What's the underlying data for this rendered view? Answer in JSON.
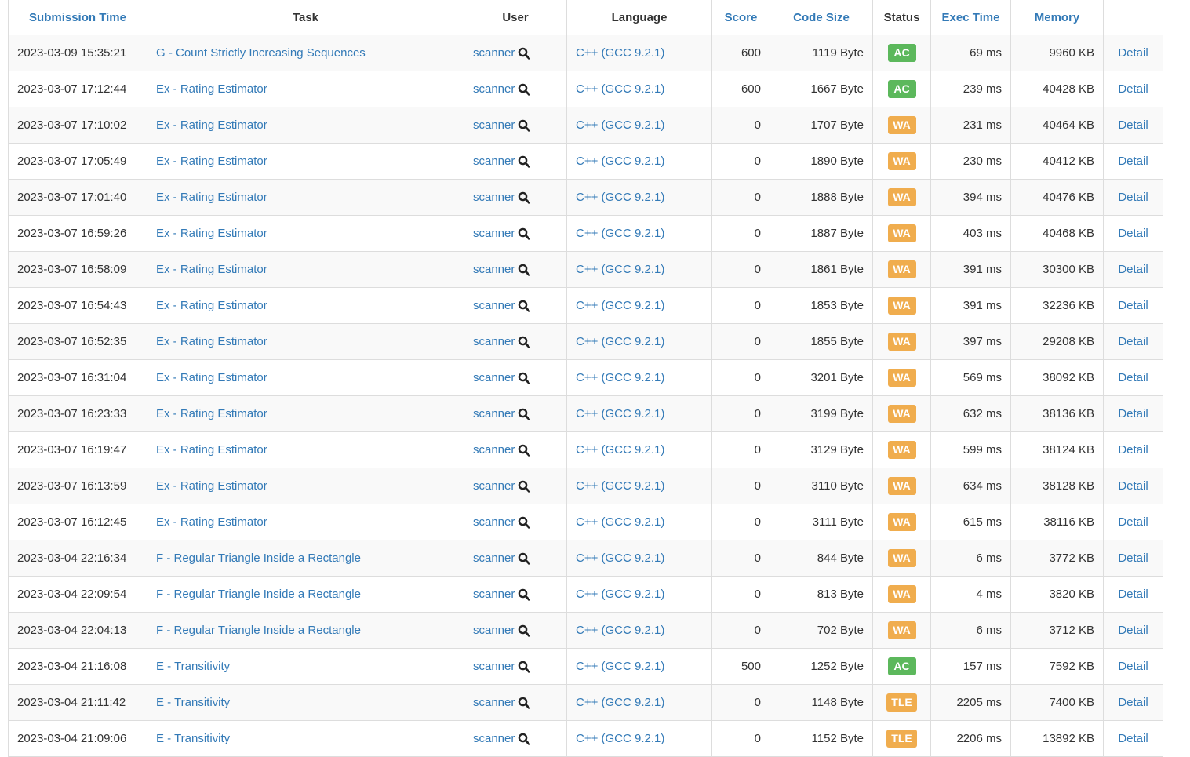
{
  "colors": {
    "link": "#337ab7",
    "ac": "#5cb85c",
    "wa": "#f0ad4e",
    "tle": "#f0ad4e",
    "stripe": "#f9f9f9",
    "border": "#dddddd"
  },
  "headers": {
    "submission_time": "Submission Time",
    "task": "Task",
    "user": "User",
    "language": "Language",
    "score": "Score",
    "code_size": "Code Size",
    "status": "Status",
    "exec_time": "Exec Time",
    "memory": "Memory",
    "detail": ""
  },
  "rows": [
    {
      "time": "2023-03-09 15:35:21",
      "task": "G - Count Strictly Increasing Sequences",
      "user": "scanner",
      "user_icon": "search-icon",
      "language": "C++ (GCC 9.2.1)",
      "score": "600",
      "code_size": "1119 Byte",
      "status": "AC",
      "exec_time": "69 ms",
      "memory": "9960 KB",
      "detail": "Detail"
    },
    {
      "time": "2023-03-07 17:12:44",
      "task": "Ex - Rating Estimator",
      "user": "scanner",
      "user_icon": "search-icon",
      "language": "C++ (GCC 9.2.1)",
      "score": "600",
      "code_size": "1667 Byte",
      "status": "AC",
      "exec_time": "239 ms",
      "memory": "40428 KB",
      "detail": "Detail"
    },
    {
      "time": "2023-03-07 17:10:02",
      "task": "Ex - Rating Estimator",
      "user": "scanner",
      "user_icon": "search-icon",
      "language": "C++ (GCC 9.2.1)",
      "score": "0",
      "code_size": "1707 Byte",
      "status": "WA",
      "exec_time": "231 ms",
      "memory": "40464 KB",
      "detail": "Detail"
    },
    {
      "time": "2023-03-07 17:05:49",
      "task": "Ex - Rating Estimator",
      "user": "scanner",
      "user_icon": "search-icon",
      "language": "C++ (GCC 9.2.1)",
      "score": "0",
      "code_size": "1890 Byte",
      "status": "WA",
      "exec_time": "230 ms",
      "memory": "40412 KB",
      "detail": "Detail"
    },
    {
      "time": "2023-03-07 17:01:40",
      "task": "Ex - Rating Estimator",
      "user": "scanner",
      "user_icon": "search-icon",
      "language": "C++ (GCC 9.2.1)",
      "score": "0",
      "code_size": "1888 Byte",
      "status": "WA",
      "exec_time": "394 ms",
      "memory": "40476 KB",
      "detail": "Detail"
    },
    {
      "time": "2023-03-07 16:59:26",
      "task": "Ex - Rating Estimator",
      "user": "scanner",
      "user_icon": "search-icon",
      "language": "C++ (GCC 9.2.1)",
      "score": "0",
      "code_size": "1887 Byte",
      "status": "WA",
      "exec_time": "403 ms",
      "memory": "40468 KB",
      "detail": "Detail"
    },
    {
      "time": "2023-03-07 16:58:09",
      "task": "Ex - Rating Estimator",
      "user": "scanner",
      "user_icon": "search-icon",
      "language": "C++ (GCC 9.2.1)",
      "score": "0",
      "code_size": "1861 Byte",
      "status": "WA",
      "exec_time": "391 ms",
      "memory": "30300 KB",
      "detail": "Detail"
    },
    {
      "time": "2023-03-07 16:54:43",
      "task": "Ex - Rating Estimator",
      "user": "scanner",
      "user_icon": "search-icon",
      "language": "C++ (GCC 9.2.1)",
      "score": "0",
      "code_size": "1853 Byte",
      "status": "WA",
      "exec_time": "391 ms",
      "memory": "32236 KB",
      "detail": "Detail"
    },
    {
      "time": "2023-03-07 16:52:35",
      "task": "Ex - Rating Estimator",
      "user": "scanner",
      "user_icon": "search-icon",
      "language": "C++ (GCC 9.2.1)",
      "score": "0",
      "code_size": "1855 Byte",
      "status": "WA",
      "exec_time": "397 ms",
      "memory": "29208 KB",
      "detail": "Detail"
    },
    {
      "time": "2023-03-07 16:31:04",
      "task": "Ex - Rating Estimator",
      "user": "scanner",
      "user_icon": "search-icon",
      "language": "C++ (GCC 9.2.1)",
      "score": "0",
      "code_size": "3201 Byte",
      "status": "WA",
      "exec_time": "569 ms",
      "memory": "38092 KB",
      "detail": "Detail"
    },
    {
      "time": "2023-03-07 16:23:33",
      "task": "Ex - Rating Estimator",
      "user": "scanner",
      "user_icon": "search-icon",
      "language": "C++ (GCC 9.2.1)",
      "score": "0",
      "code_size": "3199 Byte",
      "status": "WA",
      "exec_time": "632 ms",
      "memory": "38136 KB",
      "detail": "Detail"
    },
    {
      "time": "2023-03-07 16:19:47",
      "task": "Ex - Rating Estimator",
      "user": "scanner",
      "user_icon": "search-icon",
      "language": "C++ (GCC 9.2.1)",
      "score": "0",
      "code_size": "3129 Byte",
      "status": "WA",
      "exec_time": "599 ms",
      "memory": "38124 KB",
      "detail": "Detail"
    },
    {
      "time": "2023-03-07 16:13:59",
      "task": "Ex - Rating Estimator",
      "user": "scanner",
      "user_icon": "search-icon",
      "language": "C++ (GCC 9.2.1)",
      "score": "0",
      "code_size": "3110 Byte",
      "status": "WA",
      "exec_time": "634 ms",
      "memory": "38128 KB",
      "detail": "Detail"
    },
    {
      "time": "2023-03-07 16:12:45",
      "task": "Ex - Rating Estimator",
      "user": "scanner",
      "user_icon": "search-icon",
      "language": "C++ (GCC 9.2.1)",
      "score": "0",
      "code_size": "3111 Byte",
      "status": "WA",
      "exec_time": "615 ms",
      "memory": "38116 KB",
      "detail": "Detail"
    },
    {
      "time": "2023-03-04 22:16:34",
      "task": "F - Regular Triangle Inside a Rectangle",
      "user": "scanner",
      "user_icon": "search-icon",
      "language": "C++ (GCC 9.2.1)",
      "score": "0",
      "code_size": "844 Byte",
      "status": "WA",
      "exec_time": "6 ms",
      "memory": "3772 KB",
      "detail": "Detail"
    },
    {
      "time": "2023-03-04 22:09:54",
      "task": "F - Regular Triangle Inside a Rectangle",
      "user": "scanner",
      "user_icon": "search-icon",
      "language": "C++ (GCC 9.2.1)",
      "score": "0",
      "code_size": "813 Byte",
      "status": "WA",
      "exec_time": "4 ms",
      "memory": "3820 KB",
      "detail": "Detail"
    },
    {
      "time": "2023-03-04 22:04:13",
      "task": "F - Regular Triangle Inside a Rectangle",
      "user": "scanner",
      "user_icon": "search-icon",
      "language": "C++ (GCC 9.2.1)",
      "score": "0",
      "code_size": "702 Byte",
      "status": "WA",
      "exec_time": "6 ms",
      "memory": "3712 KB",
      "detail": "Detail"
    },
    {
      "time": "2023-03-04 21:16:08",
      "task": "E - Transitivity",
      "user": "scanner",
      "user_icon": "search-icon",
      "language": "C++ (GCC 9.2.1)",
      "score": "500",
      "code_size": "1252 Byte",
      "status": "AC",
      "exec_time": "157 ms",
      "memory": "7592 KB",
      "detail": "Detail"
    },
    {
      "time": "2023-03-04 21:11:42",
      "task": "E - Transitivity",
      "user": "scanner",
      "user_icon": "search-icon",
      "language": "C++ (GCC 9.2.1)",
      "score": "0",
      "code_size": "1148 Byte",
      "status": "TLE",
      "exec_time": "2205 ms",
      "memory": "7400 KB",
      "detail": "Detail"
    },
    {
      "time": "2023-03-04 21:09:06",
      "task": "E - Transitivity",
      "user": "scanner",
      "user_icon": "search-icon",
      "language": "C++ (GCC 9.2.1)",
      "score": "0",
      "code_size": "1152 Byte",
      "status": "TLE",
      "exec_time": "2206 ms",
      "memory": "13892 KB",
      "detail": "Detail"
    }
  ]
}
